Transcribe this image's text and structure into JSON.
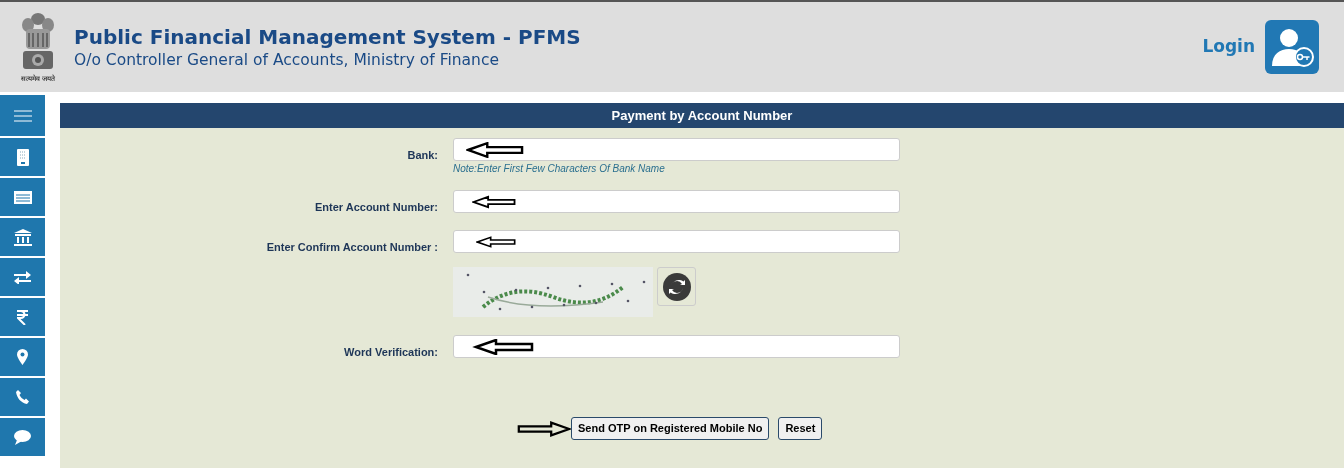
{
  "header": {
    "title": "Public Financial Management System - PFMS",
    "subtitle": "O/o Controller General of Accounts, Ministry of Finance",
    "motto": "सत्यमेव जयते",
    "login": "Login"
  },
  "sidebar": {
    "items": [
      {
        "kind": "menu"
      },
      {
        "kind": "phone"
      },
      {
        "kind": "card"
      },
      {
        "kind": "bank"
      },
      {
        "kind": "transfer"
      },
      {
        "kind": "rupee"
      },
      {
        "kind": "location"
      },
      {
        "kind": "call"
      },
      {
        "kind": "chat"
      }
    ]
  },
  "form": {
    "title": "Payment by Account Number",
    "fields": [
      {
        "kind": "text",
        "label": "Bank:",
        "note": "Note:Enter First Few Characters Of Bank Name"
      },
      {
        "kind": "text",
        "label": "Enter Account Number:"
      },
      {
        "kind": "text",
        "label": "Enter Confirm Account Number :"
      },
      {
        "kind": "captcha"
      },
      {
        "kind": "text",
        "label": "Word Verification:"
      }
    ],
    "actions": [
      {
        "kind": "arrow"
      },
      {
        "kind": "button",
        "label": "Send OTP on Registered Mobile No"
      },
      {
        "kind": "button",
        "label": "Reset"
      }
    ]
  }
}
